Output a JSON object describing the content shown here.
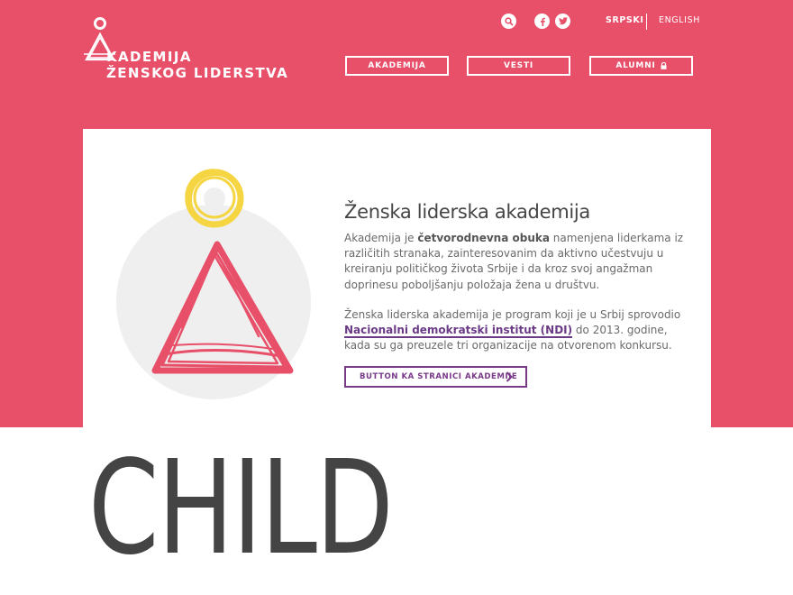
{
  "brand": {
    "line1": "KADEMIJA",
    "line2": "ŽENSKOG LIDERSTVA",
    "accent_color": "#e8506a"
  },
  "header": {
    "icons": [
      "search-icon",
      "facebook-icon",
      "twitter-icon"
    ],
    "lang_active": "SRPSKI",
    "lang_other": "ENGLISH",
    "nav": {
      "item1": "AKADEMIJA",
      "item2": "VESTI",
      "item3": "ALUMNI"
    }
  },
  "card": {
    "title": "Ženska liderska akademija",
    "para1_pre": "Akademija je ",
    "para1_bold": "četvorodnevna obuka",
    "para1_post": " namenjena liderkama iz različitih stranaka, zainteresovanim da aktivno učestvuju u kreiranju političkog života Srbije i da kroz svoj angažman doprinesu poboljšanju položaja žena u društvu.",
    "para2_pre": "Ženska liderska akademija je program koji je u Srbij sprovodio ",
    "para2_link": "Nacionalni demokratski institut (NDI)",
    "para2_post": " do 2013. godine, kada su ga preuzele tri organizacije na otvorenom konkursu.",
    "cta_label": "BUTTON KA STRANICI AKADEMIJE"
  },
  "footer_heading": "CHILD",
  "colors": {
    "pink": "#e8506a",
    "yellow": "#f5d542",
    "purple": "#7a3a8a",
    "gray_circle": "#efefef",
    "text_dark": "#444444"
  }
}
